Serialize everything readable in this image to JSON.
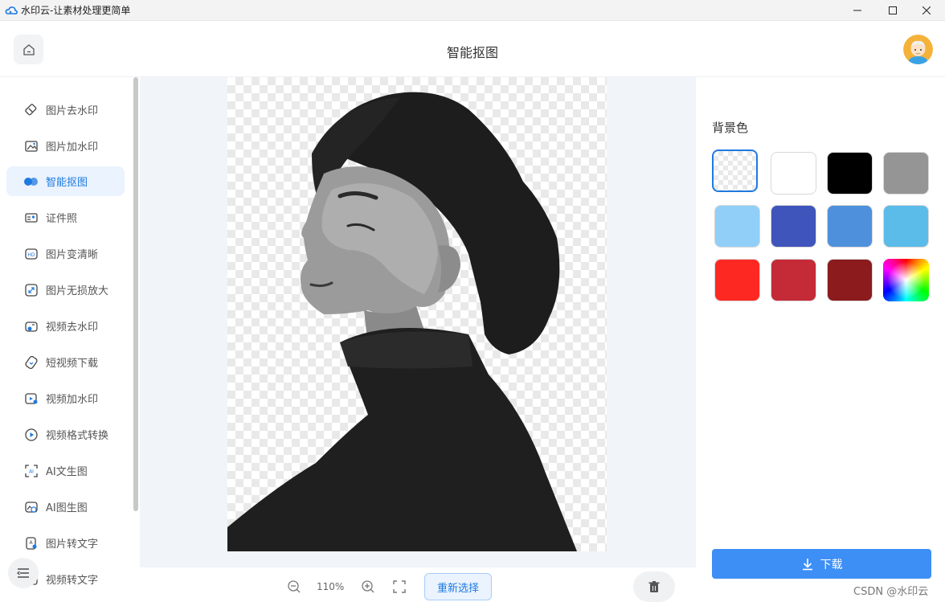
{
  "window": {
    "title": "水印云-让素材处理更简单",
    "app_icon": "cloud-logo-icon",
    "controls": [
      "minimize-icon",
      "maximize-icon",
      "close-icon"
    ]
  },
  "header": {
    "title": "智能抠图",
    "home_icon": "home-icon"
  },
  "sidebar": {
    "items": [
      {
        "label": "图片去水印",
        "icon": "eraser-icon",
        "active": false
      },
      {
        "label": "图片加水印",
        "icon": "image-icon",
        "active": false
      },
      {
        "label": "智能抠图",
        "icon": "cutout-icon",
        "active": true
      },
      {
        "label": "证件照",
        "icon": "id-card-icon",
        "active": false
      },
      {
        "label": "图片变清晰",
        "icon": "hd-icon",
        "active": false
      },
      {
        "label": "图片无损放大",
        "icon": "expand-icon",
        "active": false
      },
      {
        "label": "视频去水印",
        "icon": "video-erase-icon",
        "active": false
      },
      {
        "label": "短视频下载",
        "icon": "download-link-icon",
        "active": false
      },
      {
        "label": "视频加水印",
        "icon": "video-add-icon",
        "active": false
      },
      {
        "label": "视频格式转换",
        "icon": "play-convert-icon",
        "active": false
      },
      {
        "label": "AI文生图",
        "icon": "ai-text-icon",
        "active": false
      },
      {
        "label": "AI图生图",
        "icon": "ai-image-icon",
        "active": false
      },
      {
        "label": "图片转文字",
        "icon": "ocr-icon",
        "active": false
      },
      {
        "label": "视频转文字",
        "icon": "video-text-icon",
        "active": false
      }
    ]
  },
  "toolbar": {
    "zoom": "110%",
    "reselect_label": "重新选择"
  },
  "right_panel": {
    "bg_label": "背景色",
    "swatches": [
      {
        "name": "transparent",
        "color": "transparent",
        "selected": true
      },
      {
        "name": "white",
        "color": "#ffffff",
        "selected": false
      },
      {
        "name": "black",
        "color": "#000000",
        "selected": false
      },
      {
        "name": "gray",
        "color": "#959595",
        "selected": false
      },
      {
        "name": "light-blue",
        "color": "#91cff9",
        "selected": false
      },
      {
        "name": "royal-blue",
        "color": "#3f55bb",
        "selected": false
      },
      {
        "name": "blue",
        "color": "#4f90dd",
        "selected": false
      },
      {
        "name": "sky-blue",
        "color": "#5bbce9",
        "selected": false
      },
      {
        "name": "red",
        "color": "#fe2823",
        "selected": false
      },
      {
        "name": "crimson",
        "color": "#c52b37",
        "selected": false
      },
      {
        "name": "dark-red",
        "color": "#8b1b1d",
        "selected": false
      },
      {
        "name": "custom-rainbow",
        "color": "rainbow",
        "selected": false
      }
    ],
    "download_label": "下载"
  },
  "watermark": "CSDN @水印云",
  "colors": {
    "accent": "#1f7ae0",
    "download_button": "#3d8ff5",
    "active_bg": "#eaf3fe"
  }
}
